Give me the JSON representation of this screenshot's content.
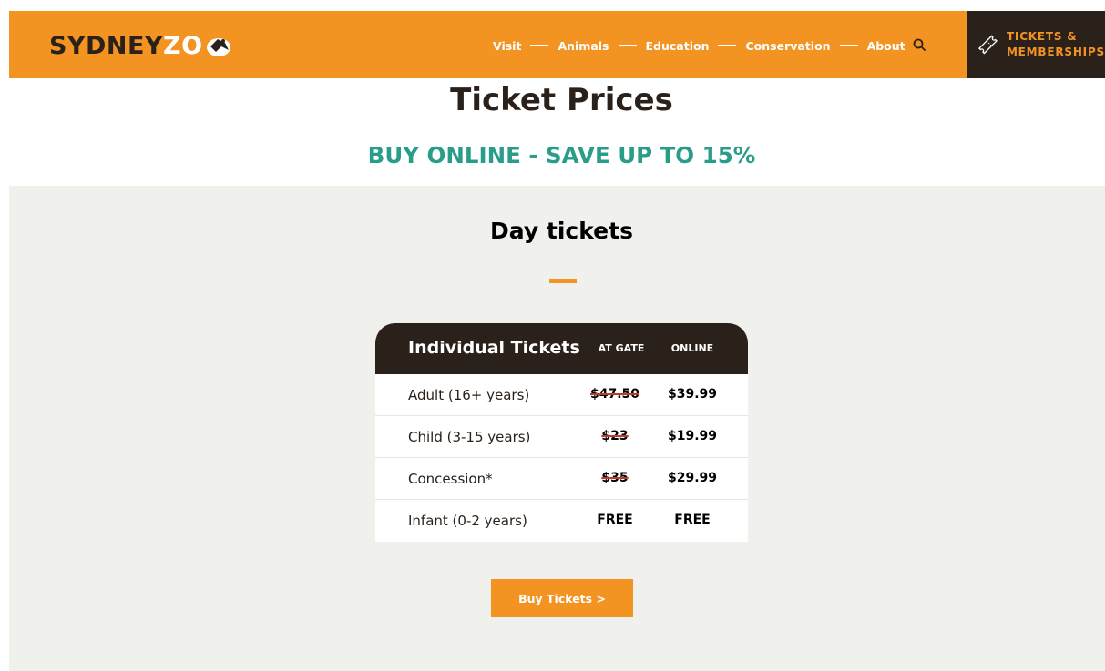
{
  "header": {
    "logo_text_primary": "SYDNEY",
    "logo_text_accent": "ZO",
    "nav": [
      "Visit",
      "Animals",
      "Education",
      "Conservation",
      "About"
    ],
    "search_icon": "search-icon",
    "tickets_button_line1": "TICKETS &",
    "tickets_button_line2": "MEMBERSHIPS"
  },
  "page": {
    "title": "Ticket Prices",
    "subtitle": "BUY ONLINE - SAVE UP TO 15%"
  },
  "day_tickets": {
    "heading": "Day tickets",
    "table": {
      "title": "Individual Tickets",
      "col_gate": "AT GATE",
      "col_online": "ONLINE",
      "rows": [
        {
          "label": "Adult (16+ years)",
          "gate": "$47.50",
          "online": "$39.99",
          "gate_struck": true
        },
        {
          "label": "Child (3-15 years)",
          "gate": "$23",
          "online": "$19.99",
          "gate_struck": true
        },
        {
          "label": "Concession*",
          "gate": "$35",
          "online": "$29.99",
          "gate_struck": true
        },
        {
          "label": "Infant (0-2 years)",
          "gate": "FREE",
          "online": "FREE",
          "gate_struck": false
        }
      ]
    },
    "buy_button": "Buy Tickets >"
  },
  "colors": {
    "brand_orange": "#f39322",
    "dark_brown": "#2b211b",
    "teal": "#2a9d8a",
    "section_bg": "#f0f0ed"
  }
}
